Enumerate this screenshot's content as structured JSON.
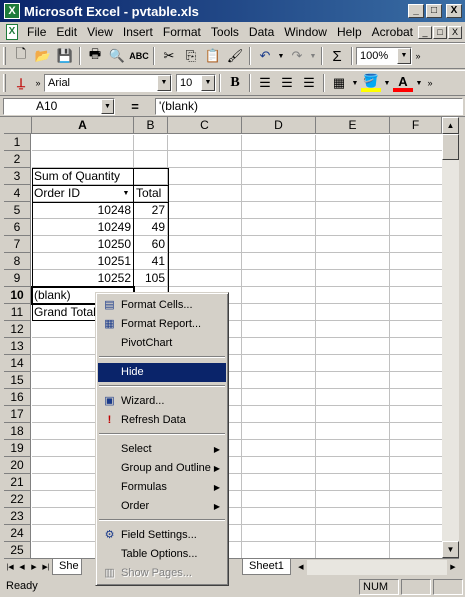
{
  "window": {
    "title": "Microsoft Excel - pvtable.xls",
    "icon": "excel-icon"
  },
  "title_buttons": {
    "minimize": "_",
    "maximize": "□",
    "close": "X"
  },
  "menubar": {
    "items": [
      "File",
      "Edit",
      "View",
      "Insert",
      "Format",
      "Tools",
      "Data",
      "Window",
      "Help",
      "Acrobat"
    ],
    "mdi_buttons": [
      "_",
      "□",
      "X"
    ]
  },
  "toolbar1": {
    "zoom": "100%"
  },
  "toolbar2": {
    "font": "Arial",
    "size": "10",
    "bold": "B"
  },
  "formula": {
    "namebox": "A10",
    "eq": "=",
    "content": "'(blank)"
  },
  "columns": [
    "A",
    "B",
    "C",
    "D",
    "E",
    "F"
  ],
  "rows": [
    "1",
    "2",
    "3",
    "4",
    "5",
    "6",
    "7",
    "8",
    "9",
    "10",
    "11",
    "12",
    "13",
    "14",
    "15",
    "16",
    "17",
    "18",
    "19",
    "20",
    "21",
    "22",
    "23",
    "24",
    "25"
  ],
  "pivot": {
    "title": "Sum of Quantity",
    "row_field": "Order ID",
    "total_header": "Total",
    "rows": [
      {
        "id": "10248",
        "qty": "27"
      },
      {
        "id": "10249",
        "qty": "49"
      },
      {
        "id": "10250",
        "qty": "60"
      },
      {
        "id": "10251",
        "qty": "41"
      },
      {
        "id": "10252",
        "qty": "105"
      }
    ],
    "blank": "(blank)",
    "grand_total": "Grand Total"
  },
  "context_menu": {
    "items": [
      {
        "label": "Format Cells...",
        "icon": "format-cells-icon"
      },
      {
        "label": "Format Report...",
        "icon": "format-report-icon"
      },
      {
        "label": "PivotChart"
      },
      {
        "label": "Hide"
      },
      {
        "label": "Wizard...",
        "icon": "wizard-icon"
      },
      {
        "label": "Refresh Data",
        "icon": "refresh-data-icon"
      },
      {
        "label": "Select"
      },
      {
        "label": "Group and Outline"
      },
      {
        "label": "Formulas"
      },
      {
        "label": "Order"
      },
      {
        "label": "Field Settings...",
        "icon": "field-settings-icon"
      },
      {
        "label": "Table Options..."
      },
      {
        "label": "Show Pages...",
        "icon": "show-pages-icon"
      }
    ]
  },
  "tabs": {
    "partial": "She",
    "sheet1": "Sheet1"
  },
  "status": {
    "ready": "Ready",
    "num": "NUM"
  }
}
